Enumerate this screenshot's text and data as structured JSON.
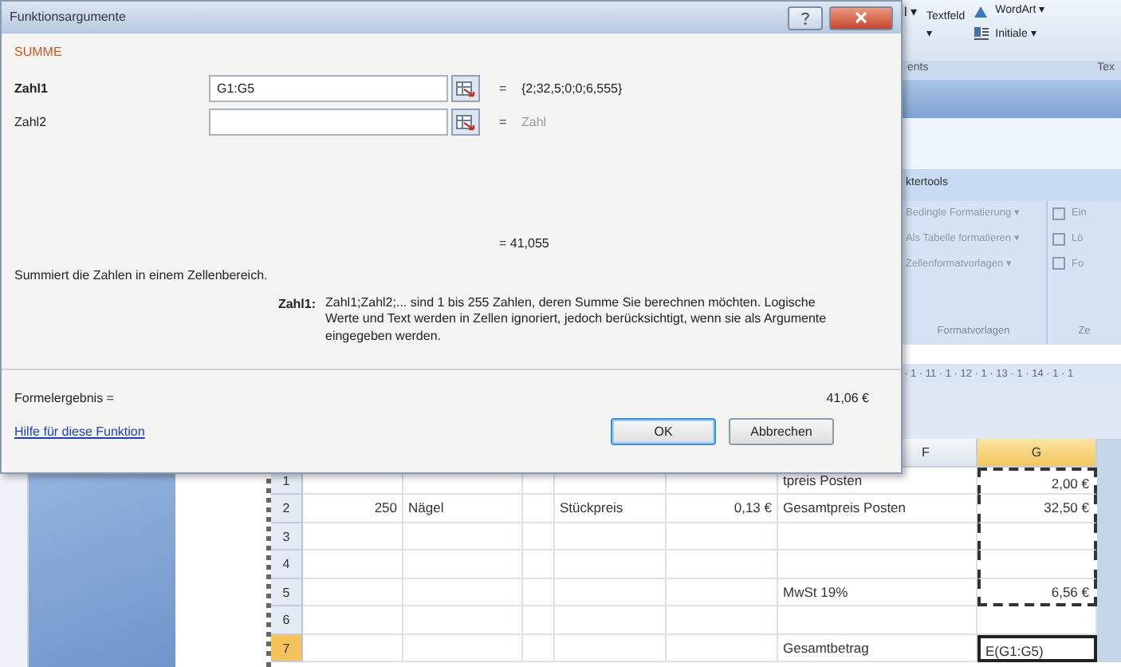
{
  "dialog": {
    "title": "Funktionsargumente",
    "function_name": "SUMME",
    "arguments": [
      {
        "label": "Zahl1",
        "active": true,
        "value": "G1:G5",
        "sign": "=",
        "result": "{2;32,5;0;0;6,555}"
      },
      {
        "label": "Zahl2",
        "active": false,
        "sign": "=",
        "result": "Zahl"
      }
    ],
    "function_result": "= 41,055",
    "summary": "Summiert die Zahlen in einem Zellenbereich.",
    "argument_help": {
      "label": "Zahl1:",
      "text": "Zahl1;Zahl2;... sind 1 bis 255 Zahlen, deren Summe Sie berechnen möchten. Logische Werte und Text werden in Zellen ignoriert, jedoch berücksichtigt, wenn sie als Argumente eingegeben werden."
    },
    "formula_result_label": "Formelergebnis =",
    "formula_result": "41,06 €",
    "help_link": "Hilfe für diese Funktion",
    "buttons": [
      {
        "label": "OK",
        "default": true
      },
      {
        "label": "Abbrechen",
        "default": false
      }
    ]
  },
  "ribbon": {
    "cut_label": "l ▾",
    "textbox": "Textfeld",
    "textbox_caret": "▾",
    "wordart": "WordArt ▾",
    "dropcap": "Initiale ▾",
    "group_left": "ents",
    "group_right": "Tex",
    "context_tab": "ktertools",
    "style_items": [
      "Bedingte Formatierung ▾",
      "Als Tabelle formatieren ▾",
      "Zellenformatvorlagen ▾"
    ],
    "style_group": "Formatvorlagen",
    "cell_items": [
      "Ein",
      "Lö",
      "Fo"
    ],
    "cell_group": "Ze",
    "ruler": "· 1 · 11 · 1 · 12 · 1 · 13 · 1 · 14 · 1 · 1"
  },
  "sheet": {
    "columns": [
      {
        "label": "F",
        "selected": false
      },
      {
        "label": "G",
        "selected": true
      }
    ],
    "rows": [
      {
        "number": "1",
        "selected": false,
        "marked": true,
        "column_6": "tpreis Posten",
        "column_7": "2,00 €"
      },
      {
        "number": "2",
        "selected": false,
        "marked": true,
        "column_1": "250",
        "column_2": "Nägel",
        "column_4": "Stückpreis",
        "column_5": "0,13 €",
        "column_6": "Gesamtpreis Posten",
        "column_7": "32,50 €"
      },
      {
        "number": "3",
        "selected": false,
        "marked": true
      },
      {
        "number": "4",
        "selected": false,
        "marked": true
      },
      {
        "number": "5",
        "selected": false,
        "marked": true,
        "column_6": "MwSt 19%",
        "column_7": "6,56 €"
      },
      {
        "number": "6",
        "selected": false,
        "marked": false
      },
      {
        "number": "7",
        "selected": true,
        "marked": false,
        "column_6": "Gesamtbetrag",
        "column_7": "E(G1:G5)"
      }
    ]
  }
}
